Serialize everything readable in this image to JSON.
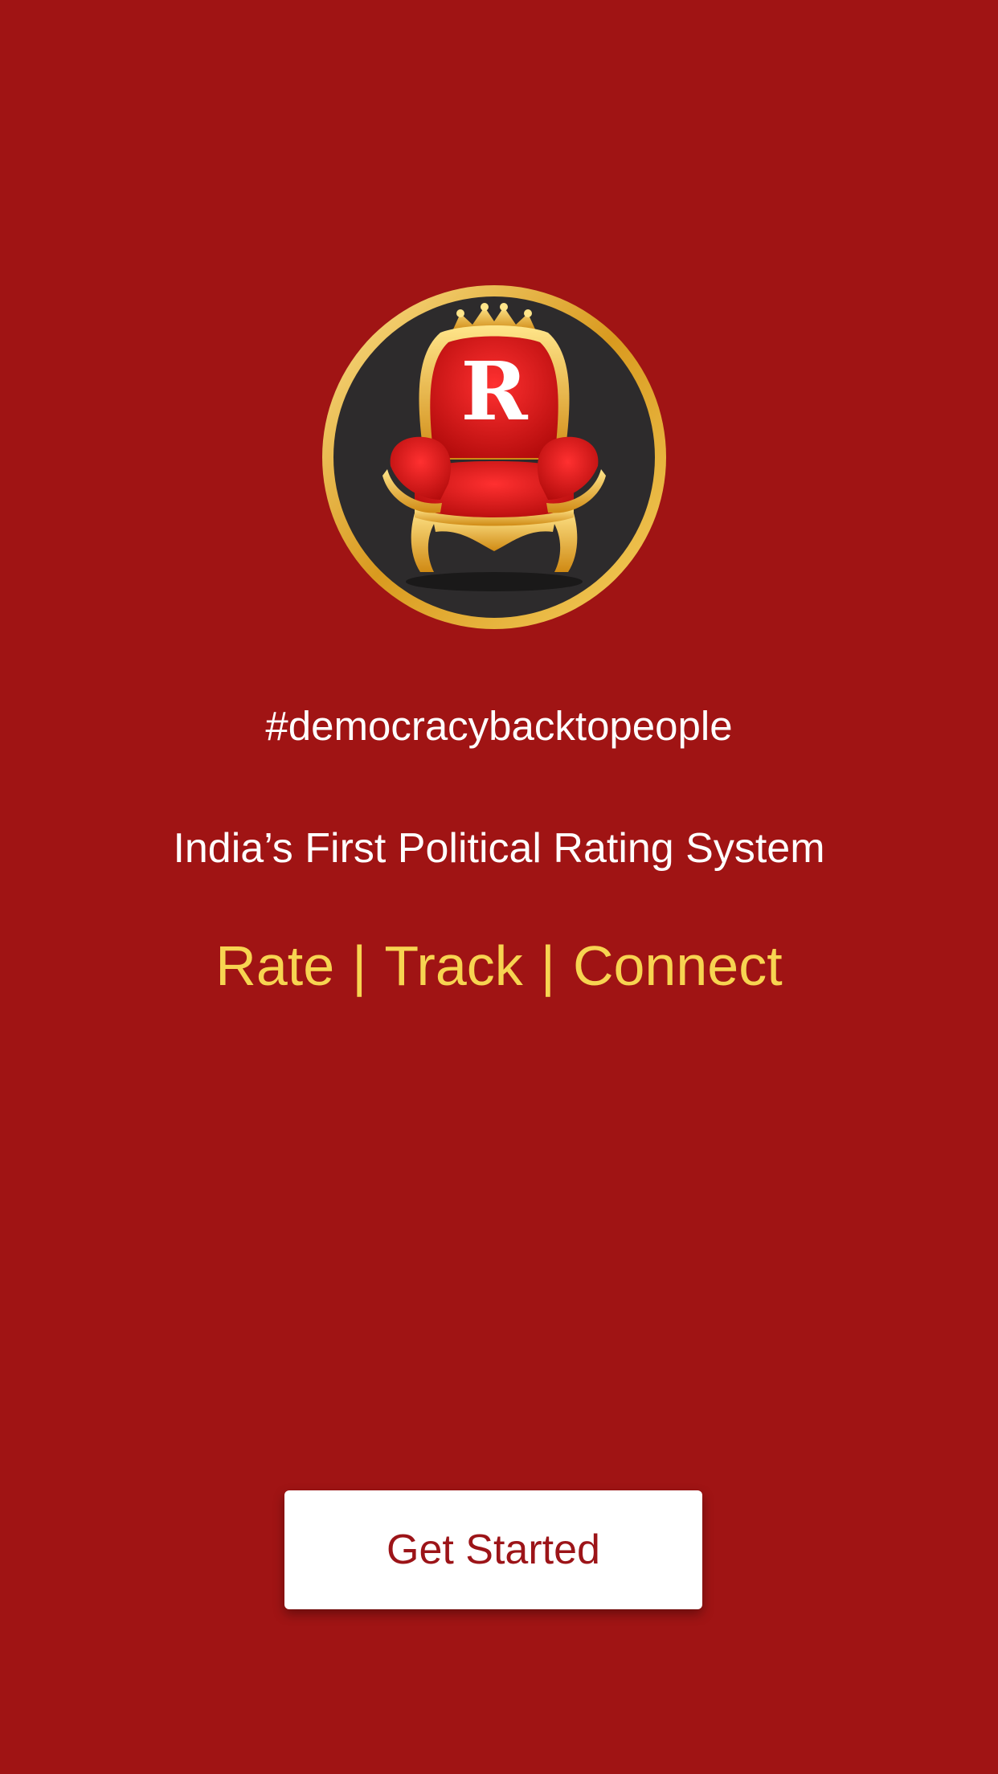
{
  "logo": {
    "icon": "throne-chair-logo",
    "letter": "R"
  },
  "hashtag": "#democracybacktopeople",
  "subtitle": "India’s First Political Rating System",
  "tagline": {
    "parts": [
      "Rate",
      "Track",
      "Connect"
    ],
    "separator": "|"
  },
  "cta": {
    "label": "Get Started"
  },
  "colors": {
    "background": "#a01414",
    "accent_gold": "#f7d451",
    "button_bg": "#ffffff",
    "button_text": "#9c1418",
    "logo_circle": "#2d2b2c"
  }
}
